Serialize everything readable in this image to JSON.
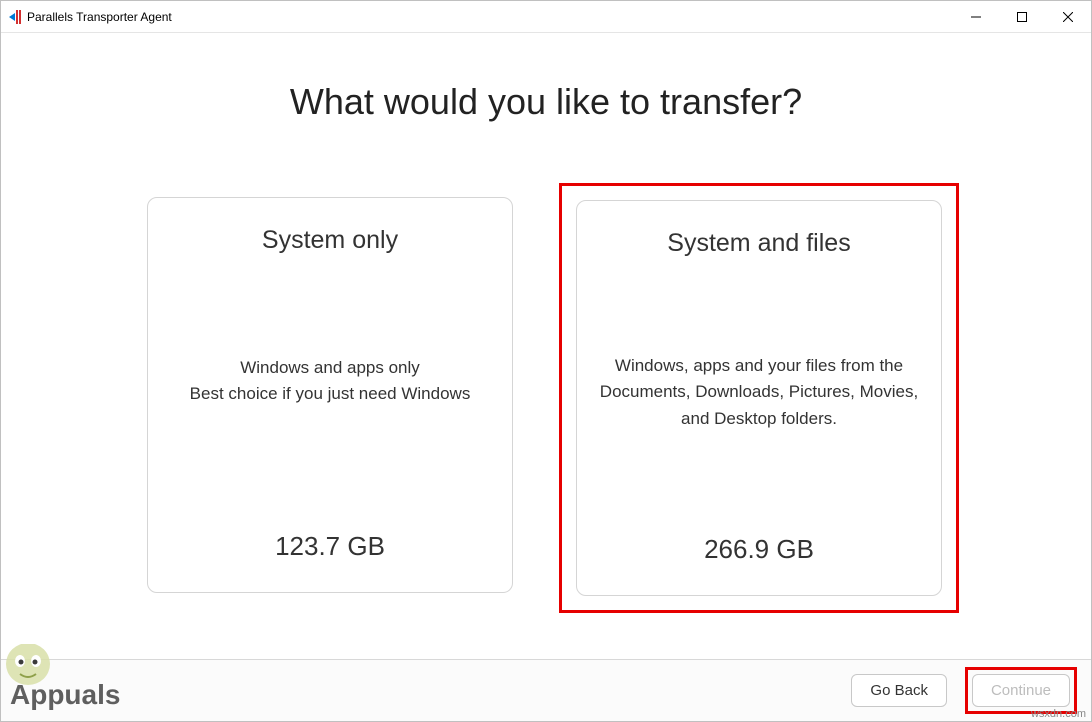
{
  "window": {
    "title": "Parallels Transporter Agent"
  },
  "heading": "What would you like to transfer?",
  "options": [
    {
      "title": "System only",
      "desc_line1": "Windows and apps only",
      "desc_line2": "Best choice if you just need Windows",
      "size": "123.7 GB",
      "selected": false
    },
    {
      "title": "System and files",
      "desc_line1": "Windows, apps and your files from the Documents, Downloads, Pictures, Movies, and Desktop folders.",
      "desc_line2": "",
      "size": "266.9 GB",
      "selected": true
    }
  ],
  "footer": {
    "go_back": "Go Back",
    "continue": "Continue"
  },
  "watermark": {
    "url": "wsxdn.com",
    "logo_text": "Appuals"
  }
}
